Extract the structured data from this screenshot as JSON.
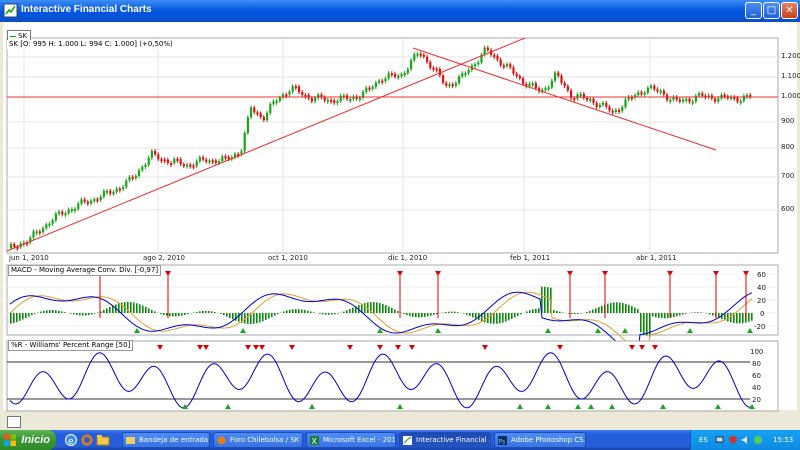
{
  "window": {
    "title": "Interactive Financial Charts"
  },
  "price_panel": {
    "legend_label": "SK",
    "info": "SK [O: 995  H: 1.000  L: 994  C: 1.000] (+0,50%)",
    "y_ticks": [
      "1.200",
      "1.100",
      "1.000",
      "900",
      "800",
      "700",
      "600"
    ],
    "x_ticks": [
      "jun 1, 2010",
      "ago 2, 2010",
      "oct 1, 2010",
      "dic 1, 2010",
      "feb 1, 2011",
      "abr 1, 2011"
    ]
  },
  "macd_panel": {
    "title": "MACD - Moving Average Conv. Div. [-0,97]",
    "y_ticks": [
      "60",
      "40",
      "20",
      "0",
      "-20"
    ]
  },
  "williams_panel": {
    "title": "%R - Williams' Percent Range [50]",
    "y_ticks": [
      "100",
      "80",
      "60",
      "40",
      "20"
    ]
  },
  "taskbar": {
    "start_label": "Inicio",
    "buttons": [
      {
        "label": "Bandeja de entrada -...",
        "icon": "mail-icon",
        "active": false
      },
      {
        "label": "Foro Chilebolsa / SK -...",
        "icon": "browser-icon",
        "active": false
      },
      {
        "label": "Microsoft Excel - 201...",
        "icon": "excel-icon",
        "active": false
      },
      {
        "label": "Interactive Financial ...",
        "icon": "java-icon",
        "active": true
      },
      {
        "label": "Adobe Photoshop CS...",
        "icon": "photoshop-icon",
        "active": false
      }
    ],
    "tray": {
      "lang": "ES",
      "time": "15:53"
    }
  },
  "colors": {
    "up": "#1aa51a",
    "down": "#dd1111",
    "macd_line": "#0000cc",
    "signal_line": "#e0a030",
    "trendline": "#e83030",
    "williams_line": "#0000cc"
  }
}
